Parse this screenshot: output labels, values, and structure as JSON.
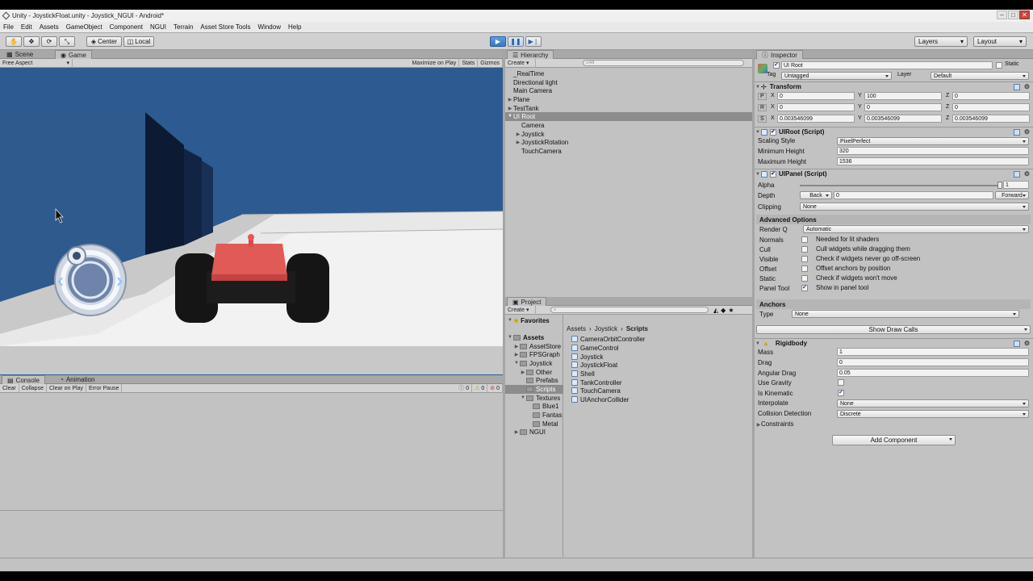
{
  "window": {
    "title": "Unity - JoystickFloat.unity - Joystick_NGUI - Android*"
  },
  "menu": [
    "File",
    "Edit",
    "Assets",
    "GameObject",
    "Component",
    "NGUI",
    "Terrain",
    "Asset Store Tools",
    "Window",
    "Help"
  ],
  "toolbar": {
    "center": "Center",
    "local": "Local",
    "layers": "Layers",
    "layout": "Layout"
  },
  "scene_tab": "Scene",
  "game_tab": "Game",
  "game_bar": {
    "aspect": "Free Aspect",
    "maximize": "Maximize on Play",
    "stats": "Stats",
    "gizmos": "Gizmos"
  },
  "hierarchy": {
    "tab": "Hierarchy",
    "create": "Create",
    "search": "All",
    "items": [
      "_RealTime",
      "Directional light",
      "Main Camera",
      "Plane",
      "TestTank",
      "UI Root",
      "Camera",
      "Joystick",
      "JoystickRotation",
      "TouchCamera"
    ]
  },
  "console": {
    "tab": "Console",
    "anim_tab": "Animation",
    "clear": "Clear",
    "collapse": "Collapse",
    "clear_on_play": "Clear on Play",
    "error_pause": "Error Pause",
    "count1": "0",
    "count2": "0",
    "count3": "0"
  },
  "project": {
    "tab": "Project",
    "create": "Create",
    "favorites": "Favorites",
    "assets": "Assets",
    "tree": [
      "AssetStore",
      "FPSGraph",
      "Joystick",
      "Other",
      "Prefabs",
      "Scripts",
      "Textures",
      "Blue1",
      "Fantas",
      "Metal",
      "NGUI"
    ],
    "breadcrumb": [
      "Assets",
      "Joystick",
      "Scripts"
    ],
    "files": [
      "CameraOrbitController",
      "GameControl",
      "Joystick",
      "JoystickFloat",
      "Shell",
      "TankController",
      "TouchCamera",
      "UIAnchorCollider"
    ]
  },
  "inspector": {
    "tab": "Inspector",
    "object_name": "UI Root",
    "static": "Static",
    "tag_label": "Tag",
    "tag_value": "Untagged",
    "layer_label": "Layer",
    "layer_value": "Default",
    "transform": {
      "title": "Transform",
      "p": "P",
      "r": "R",
      "s": "S",
      "px": "0",
      "py": "100",
      "pz": "0",
      "rx": "0",
      "ry": "0",
      "rz": "0",
      "sx": "0.003546099",
      "sy": "0.003546099",
      "sz": "0.003546099",
      "x": "X",
      "y": "Y",
      "z": "Z"
    },
    "uiroot": {
      "title": "UIRoot (Script)",
      "scaling_label": "Scaling Style",
      "scaling_value": "PixelPerfect",
      "min_label": "Minimum Height",
      "min_value": "320",
      "max_label": "Maximum Height",
      "max_value": "1536"
    },
    "uipanel": {
      "title": "UIPanel (Script)",
      "alpha_label": "Alpha",
      "alpha_value": "1",
      "alpha_level": 1.0,
      "depth_label": "Depth",
      "back": "Back",
      "depth_value": "0",
      "forward": "Forward",
      "clipping_label": "Clipping",
      "clipping_value": "None"
    },
    "advanced": {
      "title": "Advanced Options",
      "render_label": "Render Q",
      "render_value": "Automatic",
      "rows": [
        {
          "label": "Normals",
          "text": "Needed for lit shaders",
          "checked": false
        },
        {
          "label": "Cull",
          "text": "Cull widgets while dragging them",
          "checked": false
        },
        {
          "label": "Visible",
          "text": "Check if widgets never go off-screen",
          "checked": false
        },
        {
          "label": "Offset",
          "text": "Offset anchors by position",
          "checked": false
        },
        {
          "label": "Static",
          "text": "Check if widgets won't move",
          "checked": false
        },
        {
          "label": "Panel Tool",
          "text": "Show in panel tool",
          "checked": true
        }
      ]
    },
    "anchors": {
      "title": "Anchors",
      "type_label": "Type",
      "type_value": "None",
      "show_draw_calls": "Show Draw Calls"
    },
    "rigidbody": {
      "title": "Rigidbody",
      "mass_label": "Mass",
      "mass_value": "1",
      "drag_label": "Drag",
      "drag_value": "0",
      "ang_label": "Angular Drag",
      "ang_value": "0.05",
      "grav_label": "Use Gravity",
      "kin_label": "Is Kinematic",
      "interp_label": "Interpolate",
      "interp_value": "None",
      "coll_label": "Collision Detection",
      "coll_value": "Discrete",
      "constraints": "Constraints"
    },
    "add_component": "Add Component"
  }
}
